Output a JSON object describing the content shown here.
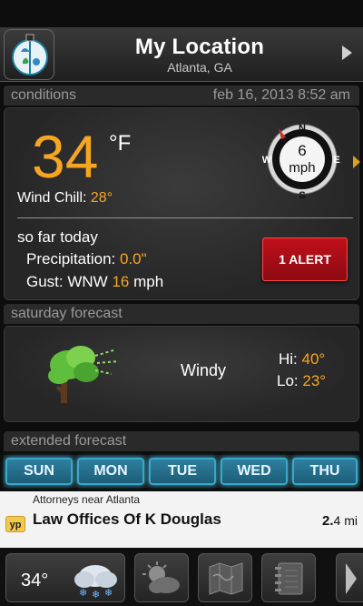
{
  "header": {
    "title": "My Location",
    "subtitle": "Atlanta, GA"
  },
  "conditions": {
    "section_label": "conditions",
    "datetime": "feb 16, 2013 8:52 am",
    "temperature": "34",
    "unit": "°F",
    "wind_chill_label": "Wind Chill: ",
    "wind_chill_value": "28°",
    "wind_speed": "6",
    "wind_unit": "mph",
    "compass": {
      "n": "N",
      "e": "E",
      "s": "S",
      "w": "W"
    },
    "today_heading": "so far today",
    "precip_label": "Precipitation: ",
    "precip_value": "0.0\"",
    "gust_label": "Gust: WNW ",
    "gust_value": "16",
    "gust_unit": " mph",
    "alert_label": "1 ALERT"
  },
  "saturday": {
    "section_label": "saturday forecast",
    "condition": "Windy",
    "hi_label": "Hi: ",
    "hi_value": "40°",
    "lo_label": "Lo: ",
    "lo_value": "23°"
  },
  "extended": {
    "section_label": "extended forecast",
    "days": [
      "SUN",
      "MON",
      "TUE",
      "WED",
      "THU"
    ]
  },
  "ad": {
    "top_text": "Attorneys near Atlanta",
    "logo": "yp",
    "title": "Law Offices Of K Douglas",
    "distance_value": "2.",
    "distance_rest": "4 mi"
  },
  "toolbar": {
    "current_temp": "34°"
  },
  "colors": {
    "accent": "#f6a623",
    "alert": "#c0101a",
    "tab": "#2f7f9f"
  }
}
